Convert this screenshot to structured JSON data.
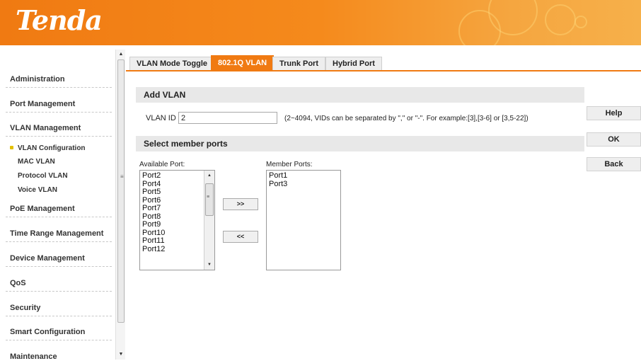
{
  "brand": {
    "logo_text": "Tenda",
    "accent_color": "#f07a12"
  },
  "sidebar": {
    "groups": [
      {
        "label": "Administration"
      },
      {
        "label": "Port Management"
      },
      {
        "label": "VLAN Management"
      },
      {
        "label": "PoE Management"
      },
      {
        "label": "Time Range Management"
      },
      {
        "label": "Device Management"
      },
      {
        "label": "QoS"
      },
      {
        "label": "Security"
      },
      {
        "label": "Smart Configuration"
      },
      {
        "label": "Maintenance"
      }
    ],
    "vlan_sub": [
      {
        "label": "VLAN Configuration",
        "active": true
      },
      {
        "label": "MAC VLAN"
      },
      {
        "label": "Protocol VLAN"
      },
      {
        "label": "Voice VLAN"
      }
    ]
  },
  "tabs": [
    {
      "label": "VLAN Mode Toggle",
      "active": false
    },
    {
      "label": "802.1Q VLAN",
      "active": true
    },
    {
      "label": "Trunk Port",
      "active": false
    },
    {
      "label": "Hybrid Port",
      "active": false
    }
  ],
  "add_vlan": {
    "title": "Add VLAN",
    "vlan_id_label": "VLAN ID",
    "vlan_id_value": "2",
    "hint": "(2~4094, VIDs can be separated by \",\" or \"-\". For example:[3],[3-6] or [3,5-22])"
  },
  "members": {
    "title": "Select member ports",
    "available_label": "Available Port:",
    "member_label": "Member Ports:",
    "available_ports": [
      "Port2",
      "Port4",
      "Port5",
      "Port6",
      "Port7",
      "Port8",
      "Port9",
      "Port10",
      "Port11",
      "Port12"
    ],
    "member_ports": [
      "Port1",
      "Port3"
    ],
    "add_label": ">>",
    "remove_label": "<<"
  },
  "actions": {
    "help": "Help",
    "ok": "OK",
    "back": "Back"
  }
}
